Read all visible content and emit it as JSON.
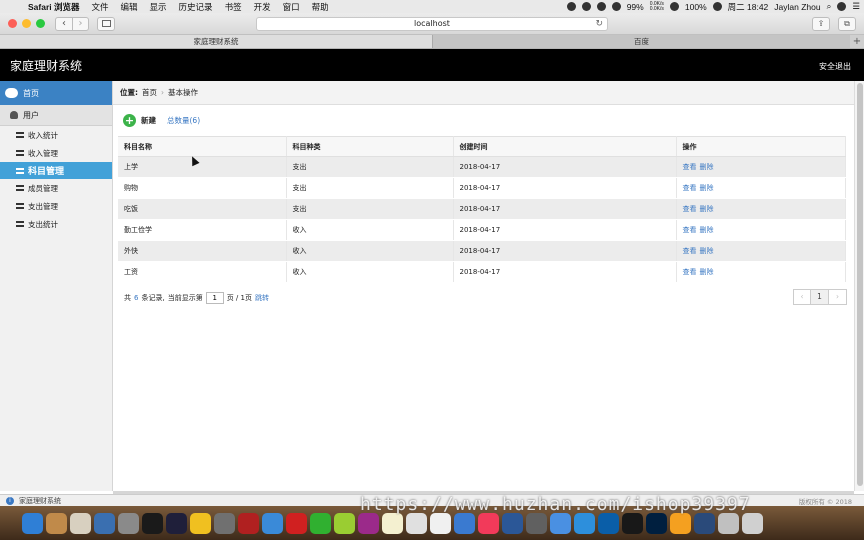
{
  "menubar": {
    "app": "Safari 浏览器",
    "items": [
      "文件",
      "编辑",
      "显示",
      "历史记录",
      "书签",
      "开发",
      "窗口",
      "帮助"
    ],
    "battery": "99%",
    "network_up": "0.0K/s",
    "network_down": "0.0K/s",
    "volume": "100%",
    "clock": "周二 18:42",
    "user": "Jaylan Zhou"
  },
  "browser": {
    "url": "localhost",
    "tabs": [
      {
        "label": "家庭理财系统"
      },
      {
        "label": "百度"
      }
    ]
  },
  "header": {
    "title": "家庭理财系统",
    "logout": "安全退出"
  },
  "sidebar": {
    "home": "首页",
    "user": "用户",
    "items": [
      {
        "label": "收入统计"
      },
      {
        "label": "收入管理"
      },
      {
        "label": "科目管理"
      },
      {
        "label": "成员管理"
      },
      {
        "label": "支出管理"
      },
      {
        "label": "支出统计"
      }
    ]
  },
  "breadcrumb": {
    "label": "位置:",
    "home": "首页",
    "sep": "›",
    "current": "基本操作"
  },
  "actions": {
    "new_label": "新建",
    "total_label": "总数量(6)"
  },
  "table": {
    "headers": [
      "科目名称",
      "科目种类",
      "创建时间",
      "操作"
    ],
    "view_label": "查看",
    "delete_label": "删除",
    "rows": [
      {
        "name": "上学",
        "type": "支出",
        "date": "2018-04-17"
      },
      {
        "name": "购物",
        "type": "支出",
        "date": "2018-04-17"
      },
      {
        "name": "吃饭",
        "type": "支出",
        "date": "2018-04-17"
      },
      {
        "name": "勤工俭学",
        "type": "收入",
        "date": "2018-04-17"
      },
      {
        "name": "外快",
        "type": "收入",
        "date": "2018-04-17"
      },
      {
        "name": "工资",
        "type": "收入",
        "date": "2018-04-17"
      }
    ]
  },
  "pager": {
    "prefix": "共",
    "count": "6",
    "suffix": "条记录,",
    "current_label": "当前显示第",
    "page_value": "1",
    "of_label": "页 / 1页",
    "jump": "跳转",
    "prev": "‹",
    "page": "1",
    "next": "›"
  },
  "status": {
    "text": "家庭理财系统",
    "copyright": "版权所有 © 2018"
  },
  "watermark": "https://www.huzhan.com/ishop39397",
  "dock_colors": [
    "#2f7fd6",
    "#c08a4a",
    "#d8d0c0",
    "#3a6fb0",
    "#8a8a8a",
    "#1a1a1a",
    "#1f1f3a",
    "#f0c020",
    "#707070",
    "#b02020",
    "#3a8ad8",
    "#d02020",
    "#30b030",
    "#9acd32",
    "#9b2a8a",
    "#f4f0d0",
    "#e0e0e0",
    "#f0f0f0",
    "#3a7ad0",
    "#f23a5a",
    "#2b5797",
    "#606060",
    "#4a90e2",
    "#2d8fdc",
    "#0a5ea8",
    "#181818",
    "#001f3f",
    "#f4a020",
    "#2a4a7a",
    "#c0c0c0",
    "#d0d0d0"
  ]
}
